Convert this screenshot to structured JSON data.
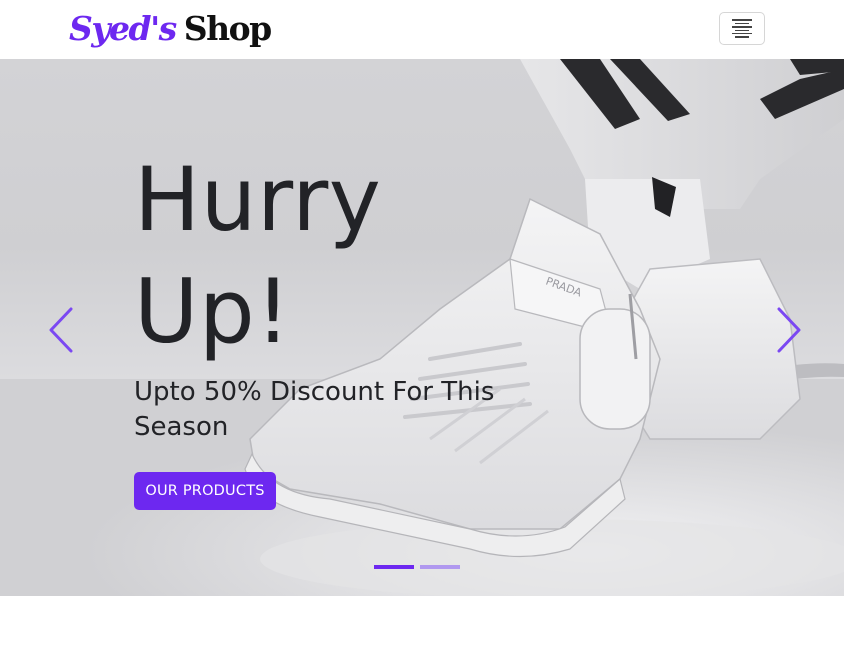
{
  "navbar": {
    "brand_part1": "Syed's",
    "brand_part2": "Shop",
    "toggler_icon": "hamburger-menu-icon"
  },
  "hero": {
    "headline_line1": "Hurry",
    "headline_line2": "Up!",
    "subline": "Upto 50% Discount For This Season",
    "cta_label": "OUR PRODUCTS",
    "shoe_tag_text": "PRADA",
    "prev_icon": "chevron-left-icon",
    "next_icon": "chevron-right-icon",
    "indicators": [
      {
        "active": true
      },
      {
        "active": false
      }
    ]
  },
  "colors": {
    "accent": "#6d28f0",
    "text_dark": "#222327",
    "hero_bg": "#d3d3d6"
  }
}
